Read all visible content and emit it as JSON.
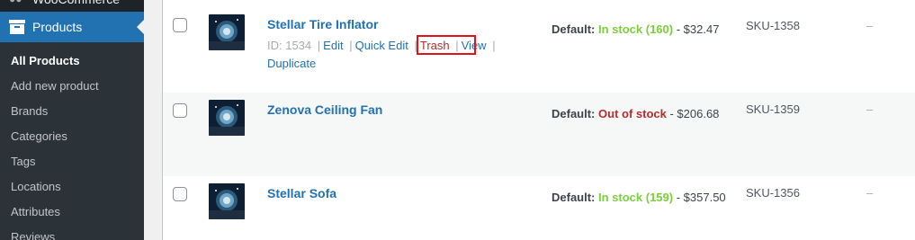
{
  "sidebar": {
    "prev_item_label": "WooCommerce",
    "active_menu": {
      "label": "Products",
      "icon": "products-archive-icon"
    },
    "submenu": [
      {
        "label": "All Products",
        "current": true
      },
      {
        "label": "Add new product"
      },
      {
        "label": "Brands"
      },
      {
        "label": "Categories"
      },
      {
        "label": "Tags"
      },
      {
        "label": "Locations"
      },
      {
        "label": "Attributes"
      },
      {
        "label": "Reviews"
      }
    ]
  },
  "products": [
    {
      "name": "Stellar Tire Inflator",
      "id_label": "ID: 1534",
      "actions": {
        "edit": "Edit",
        "quick_edit": "Quick Edit",
        "trash": "Trash",
        "view": "View",
        "duplicate": "Duplicate"
      },
      "stock_prefix": "Default:",
      "stock_status": "In stock (160)",
      "price": "- $32.47",
      "sku": "SKU-1358",
      "extra": "–"
    },
    {
      "name": "Zenova Ceiling Fan",
      "stock_prefix": "Default:",
      "stock_status": "Out of stock",
      "price": "- $206.68",
      "sku": "SKU-1359",
      "extra": "–"
    },
    {
      "name": "Stellar Sofa",
      "stock_prefix": "Default:",
      "stock_status": "In stock (159)",
      "price": "- $357.50",
      "sku": "SKU-1356",
      "extra": "–"
    }
  ],
  "colors": {
    "sidebar_bg": "#1d2327",
    "accent": "#2271b1",
    "in_stock": "#7ad03a",
    "out_of_stock": "#b32d2e",
    "highlight": "#e3111a"
  }
}
